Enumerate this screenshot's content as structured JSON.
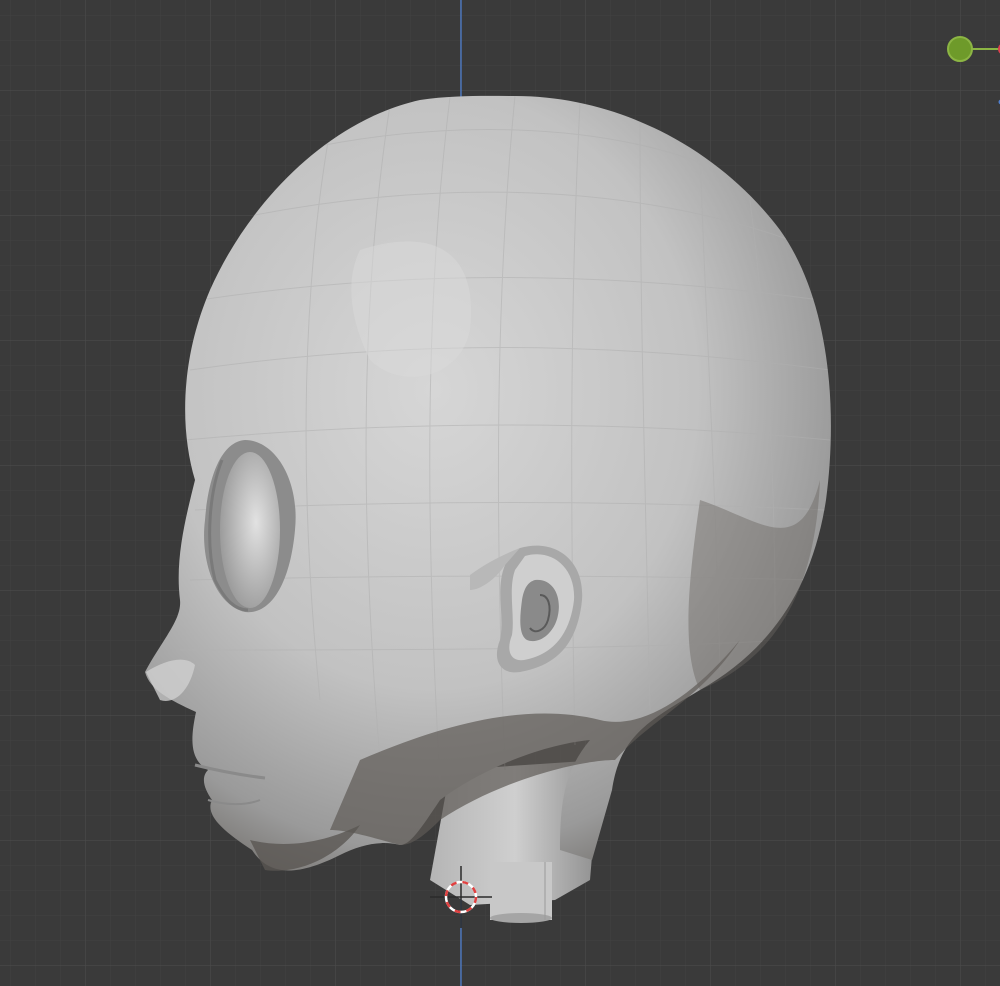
{
  "viewport": {
    "background": "#3a3a3a",
    "grid_minor_color": "#424242",
    "grid_major_color": "#4a4a4a",
    "z_axis_color": "#4e7fd0"
  },
  "model": {
    "skin_color": "#c4c4c4",
    "shadow_color": "#5e5a55",
    "highlight_color": "#d8d8d8"
  },
  "gizmo": {
    "y_axis_color": "#8cb544",
    "x_axis_color": "#e0404e"
  },
  "cursor": {
    "ring_color_a": "#e04040",
    "ring_color_b": "#ffffff"
  }
}
